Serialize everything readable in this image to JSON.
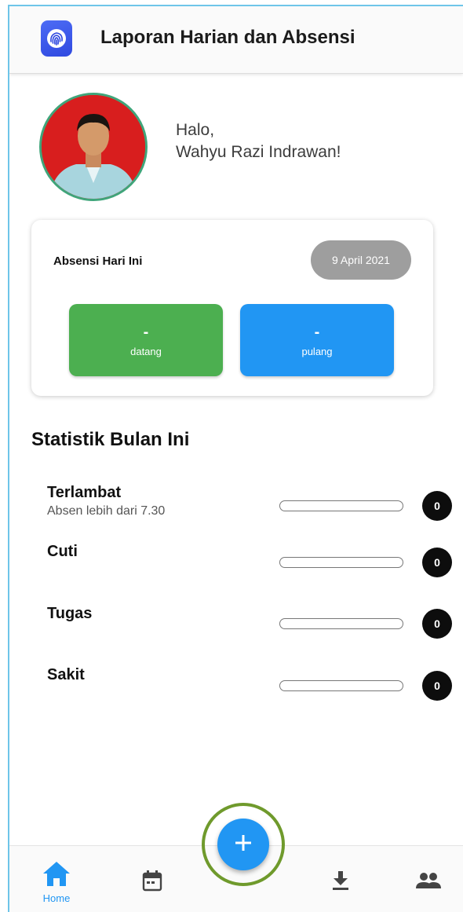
{
  "app": {
    "title": "Laporan Harian dan Absensi",
    "logo_icon": "fingerprint-icon"
  },
  "profile": {
    "greeting": "Halo,",
    "name": "Wahyu Razi Indrawan!"
  },
  "attendance": {
    "title": "Absensi Hari Ini",
    "date": "9 April 2021",
    "check_in": {
      "value": "-",
      "label": "datang"
    },
    "check_out": {
      "value": "-",
      "label": "pulang"
    }
  },
  "stats": {
    "title": "Statistik Bulan Ini",
    "items": [
      {
        "name": "Terlambat",
        "subtitle": "Absen lebih dari 7.30",
        "count": "0",
        "progress": 0
      },
      {
        "name": "Cuti",
        "subtitle": "",
        "count": "0",
        "progress": 0
      },
      {
        "name": "Tugas",
        "subtitle": "",
        "count": "0",
        "progress": 0
      },
      {
        "name": "Sakit",
        "subtitle": "",
        "count": "0",
        "progress": 0
      }
    ]
  },
  "nav": {
    "items": [
      {
        "label": "Home",
        "icon": "home-icon",
        "active": true
      },
      {
        "label": "",
        "icon": "calendar-icon",
        "active": false
      },
      {
        "label": "",
        "icon": "download-icon",
        "active": false
      },
      {
        "label": "",
        "icon": "people-icon",
        "active": false
      }
    ],
    "fab_icon": "plus-icon"
  },
  "colors": {
    "primary": "#2196f3",
    "check_in": "#4caf50",
    "check_out": "#2196f3",
    "date_chip": "#9e9e9e",
    "count_badge": "#0d0d0d"
  }
}
